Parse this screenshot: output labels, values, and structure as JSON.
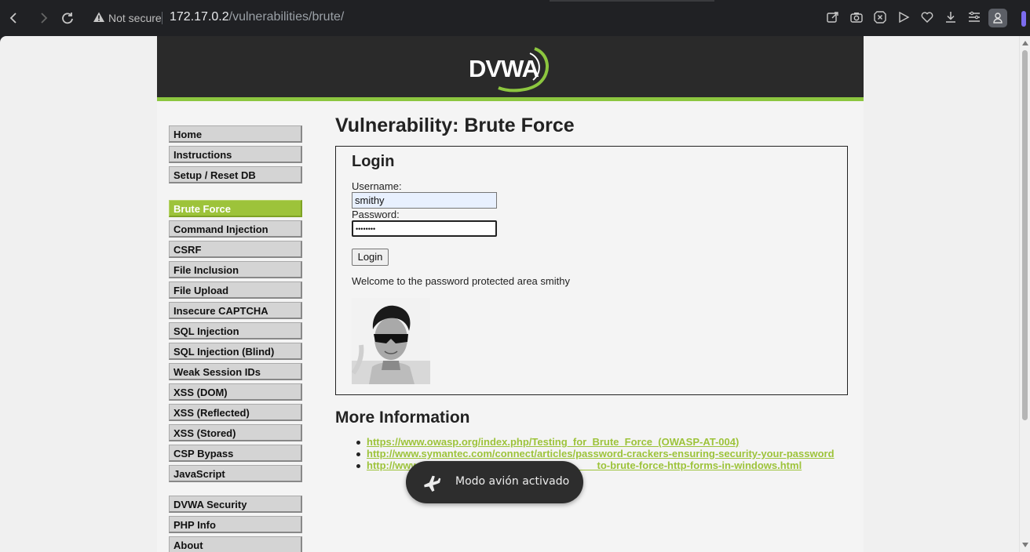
{
  "browser": {
    "security_label": "Not secure",
    "url_host": "172.17.0.2",
    "url_path": "/vulnerabilities/brute/",
    "icons": [
      "back-icon",
      "forward-icon",
      "reload-icon",
      "warning-icon",
      "share-icon",
      "camera-icon",
      "shield-icon",
      "play-icon",
      "heart-icon",
      "download-icon",
      "menu-icon",
      "profile-icon"
    ]
  },
  "header": {
    "logo_text": "DVWA",
    "accent": "#8cc63f"
  },
  "sidebar": {
    "group1": [
      "Home",
      "Instructions",
      "Setup / Reset DB"
    ],
    "group2": [
      "Brute Force",
      "Command Injection",
      "CSRF",
      "File Inclusion",
      "File Upload",
      "Insecure CAPTCHA",
      "SQL Injection",
      "SQL Injection (Blind)",
      "Weak Session IDs",
      "XSS (DOM)",
      "XSS (Reflected)",
      "XSS (Stored)",
      "CSP Bypass",
      "JavaScript"
    ],
    "group3": [
      "DVWA Security",
      "PHP Info",
      "About"
    ],
    "active": "Brute Force"
  },
  "main": {
    "title": "Vulnerability: Brute Force",
    "form_title": "Login",
    "username_label": "Username:",
    "username_value": "smithy",
    "password_label": "Password:",
    "password_value": "••••••••",
    "login_button": "Login",
    "welcome": "Welcome to the password protected area smithy",
    "more_info_title": "More Information",
    "links": [
      "https://www.owasp.org/index.php/Testing_for_Brute_Force_(OWASP-AT-004)",
      "http://www.symantec.com/connect/articles/password-crackers-ensuring-security-your-password",
      "http://www.                                                              to-brute-force-http-forms-in-windows.html"
    ]
  },
  "toast": {
    "text": "Modo avión activado"
  }
}
